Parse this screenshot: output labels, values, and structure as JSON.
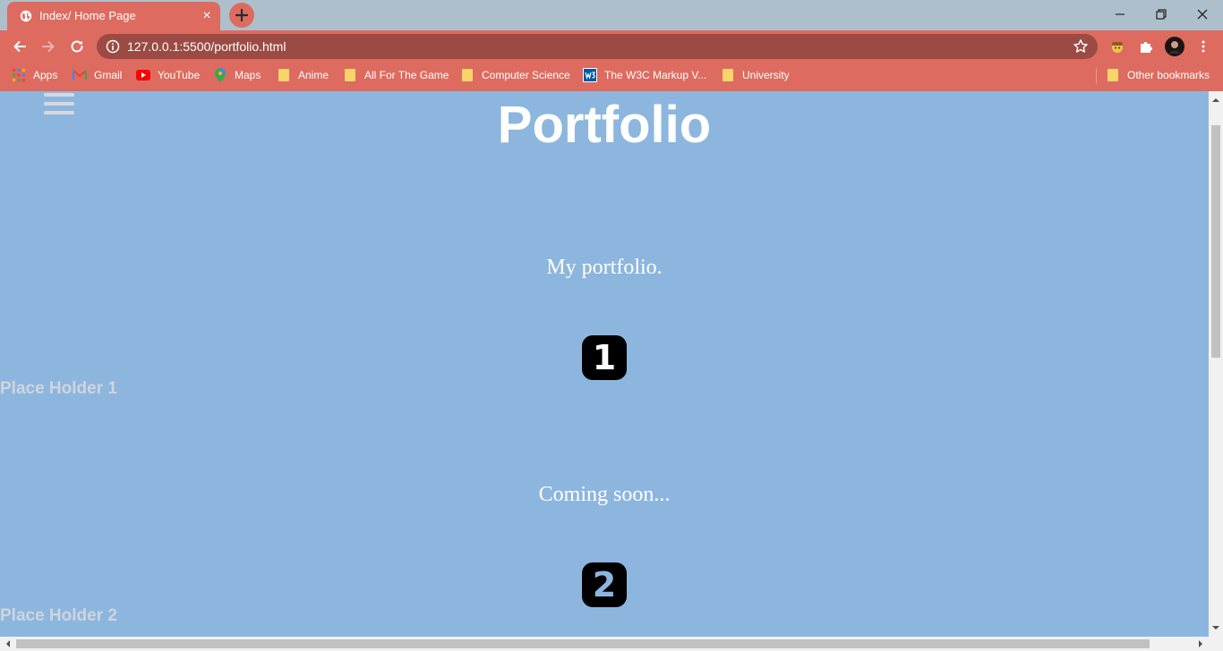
{
  "browser": {
    "tab": {
      "title": "Index/ Home Page",
      "close_glyph": "×"
    },
    "address_bar": {
      "url": "127.0.0.1:5500/portfolio.html"
    },
    "bookmarks": [
      {
        "label": "Apps",
        "icon": "apps-grid-icon"
      },
      {
        "label": "Gmail",
        "icon": "gmail-icon"
      },
      {
        "label": "YouTube",
        "icon": "youtube-icon"
      },
      {
        "label": "Maps",
        "icon": "maps-icon"
      },
      {
        "label": "Anime",
        "icon": "folder-icon"
      },
      {
        "label": "All For The Game",
        "icon": "folder-icon"
      },
      {
        "label": "Computer Science",
        "icon": "folder-icon"
      },
      {
        "label": "The W3C Markup V...",
        "icon": "w3c-icon"
      },
      {
        "label": "University",
        "icon": "folder-icon"
      }
    ],
    "other_bookmarks": "Other bookmarks",
    "colors": {
      "theme": "#dd6b5f",
      "omnibox": "#9b4b44",
      "tabstrip": "#aebfcc"
    }
  },
  "page": {
    "title": "Portfolio",
    "sections": [
      {
        "text": "My portfolio.",
        "number": "1",
        "placeholder": "Place Holder 1"
      },
      {
        "text": "Coming soon...",
        "number": "2",
        "placeholder": "Place Holder 2"
      }
    ],
    "colors": {
      "background": "#8db6de",
      "badge": "#000000"
    }
  }
}
